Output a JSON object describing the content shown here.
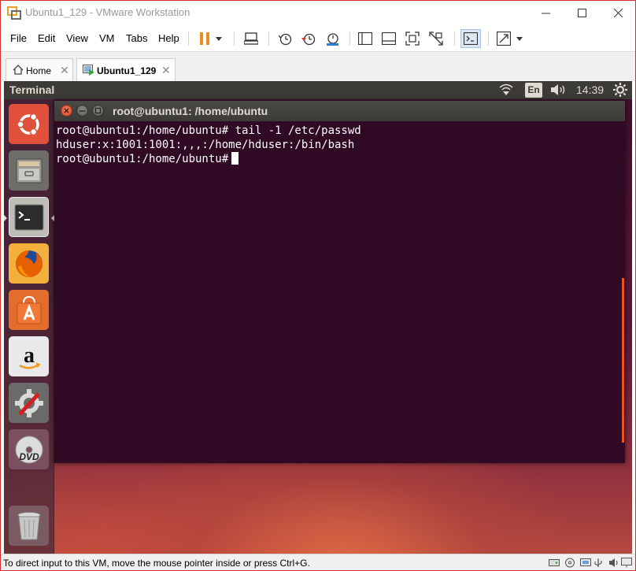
{
  "window": {
    "title": "Ubuntu1_129 - VMware Workstation"
  },
  "menu": {
    "items": [
      "File",
      "Edit",
      "View",
      "VM",
      "Tabs",
      "Help"
    ]
  },
  "tabs": [
    {
      "label": "Home"
    },
    {
      "label": "Ubuntu1_129"
    }
  ],
  "guest": {
    "topbar_title": "Terminal",
    "language": "En",
    "clock": "14:39"
  },
  "terminal": {
    "title": "root@ubuntu1: /home/ubuntu",
    "lines": [
      "root@ubuntu1:/home/ubuntu# tail -1 /etc/passwd",
      "hduser:x:1001:1001:,,,:/home/hduser:/bin/bash",
      "root@ubuntu1:/home/ubuntu#"
    ]
  },
  "status": {
    "text": "To direct input to this VM, move the mouse pointer inside or press Ctrl+G."
  },
  "colors": {
    "ubuntu_orange": "#e95420",
    "terminal_bg": "#300a24",
    "panel_bg": "#3c3b37",
    "pause_orange": "#f08c1e"
  }
}
